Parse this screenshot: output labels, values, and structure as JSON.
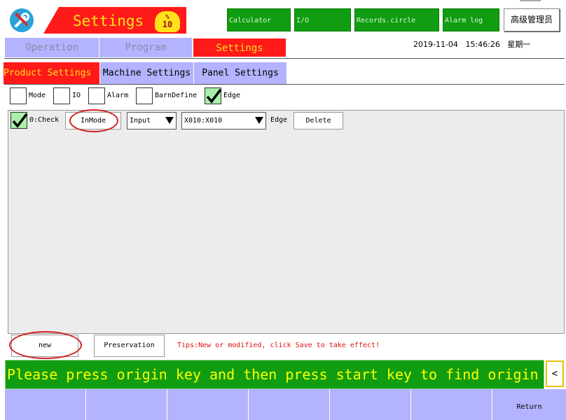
{
  "header": {
    "title": "Settings",
    "badge_symbol": "%",
    "badge_value": "10",
    "tools": [
      "Calculator",
      "I/O",
      "Records.circle",
      "Alarm log"
    ],
    "user": "高级管理员",
    "colors": {
      "accent_red": "#ff1a1a",
      "accent_yellow": "#ffe21a",
      "green": "#119d11",
      "lavender": "#b3b3ff"
    }
  },
  "main_tabs": [
    {
      "label": "Operation",
      "active": false
    },
    {
      "label": "Program",
      "active": false
    },
    {
      "label": "Settings",
      "active": true
    }
  ],
  "datetime": {
    "date": "2019-11-04",
    "time": "15:46:26",
    "weekday": "星期一"
  },
  "sub_tabs": [
    {
      "label": "Product Settings",
      "active": true
    },
    {
      "label": "Machine Settings",
      "active": false
    },
    {
      "label": "Panel Settings",
      "active": false
    }
  ],
  "filters": [
    {
      "label": "Mode",
      "checked": false
    },
    {
      "label": "IO",
      "checked": false
    },
    {
      "label": "Alarm",
      "checked": false
    },
    {
      "label": "BarnDefine",
      "checked": false
    },
    {
      "label": "Edge",
      "checked": true
    }
  ],
  "rows": [
    {
      "checked": true,
      "label": "0:Check",
      "mode_button": "InMode",
      "type_select": "Input",
      "port_select": "X010:X010",
      "edge_label": "Edge",
      "delete_button": "Delete"
    }
  ],
  "bottom": {
    "new_button": "new",
    "save_button": "Preservation",
    "tips": "Tips:New or modified, click Save to take effect!",
    "marquee": "Please press origin key and then press start key to find origin",
    "marquee_arrow": "<"
  },
  "nav": {
    "return_label": "Return"
  }
}
